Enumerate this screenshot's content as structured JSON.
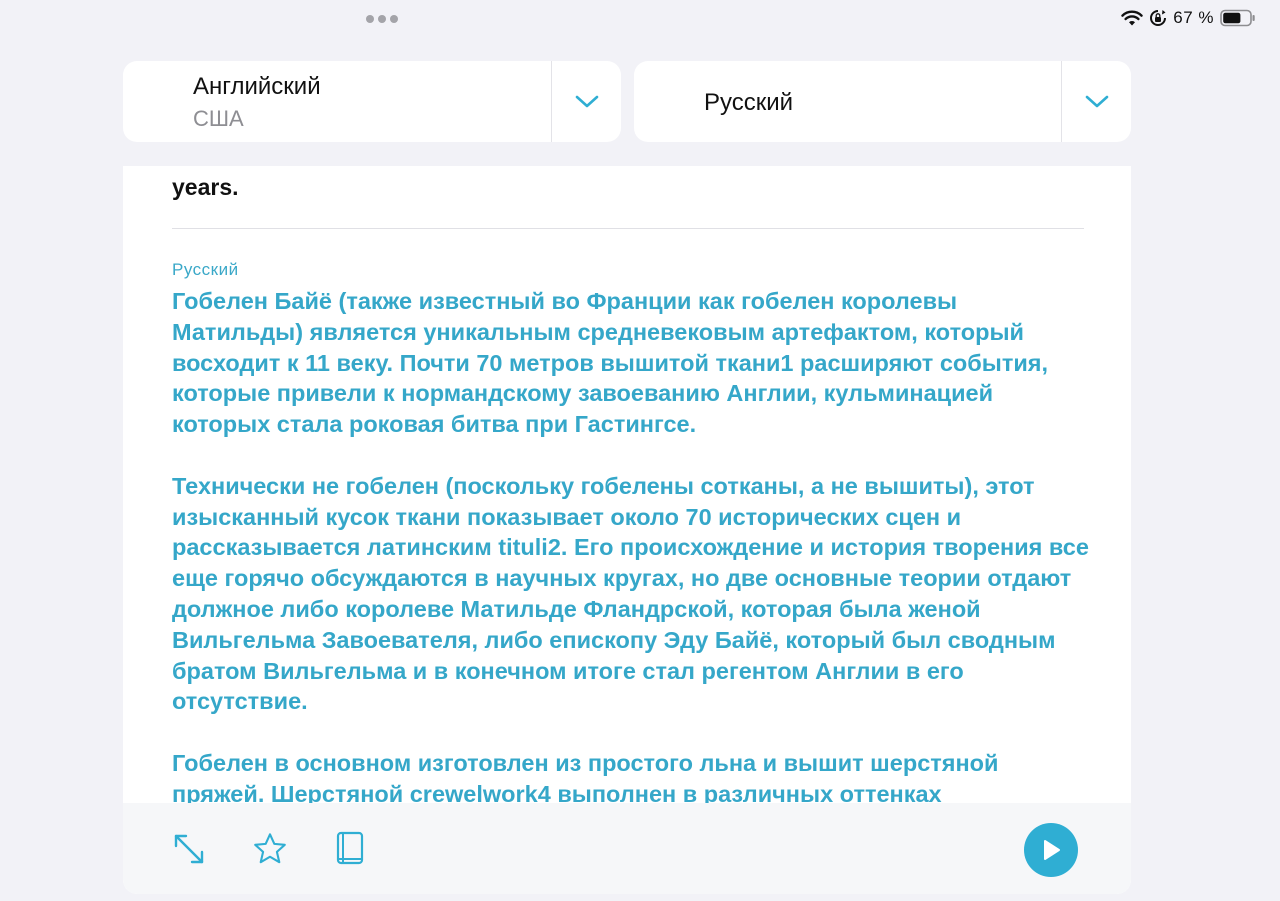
{
  "status_bar": {
    "battery_percent": "67 %",
    "battery_level": 0.67,
    "icons": [
      "wifi-icon",
      "lock-rotation-icon",
      "battery-icon"
    ]
  },
  "source_language": {
    "name": "Английский",
    "region": "США",
    "icon": "chevron-down-icon"
  },
  "target_language": {
    "name": "Русский",
    "icon": "chevron-down-icon"
  },
  "source_text_tail": "years.",
  "translation": {
    "label": "Русский",
    "paragraphs": [
      "Гобелен Байё (также известный во Франции как гобелен королевы Матильды) является уникальным средневековым артефактом, который восходит к 11 веку. Почти 70 метров вышитой ткани1 расширяют события, которые привели к нормандскому завоеванию Англии, кульминацией которых стала роковая битва при Гастингсе.",
      "Технически не гобелен (поскольку гобелены сотканы, а не вышиты), этот изысканный кусок ткани показывает около 70 исторических сцен и рассказывается латинским tituli2. Его происхождение и история творения все еще горячо обсуждаются в научных кругах, но две основные теории отдают должное либо королеве Матильде Фландрской, которая была женой Вильгельма Завоевателя, либо епископу Эду Байё, который был сводным братом Вильгельма и в конечном итоге стал регентом Англии в его отсутствие.",
      "Гобелен в основном изготовлен из простого льна и вышит шерстяной пряжей. Шерстяной crewelwork4 выполнен в различных оттенках"
    ],
    "color": "#35a7c9"
  },
  "toolbar": {
    "icons": [
      "expand-icon",
      "star-icon",
      "book-icon",
      "play-icon"
    ],
    "accent": "#2faed3"
  }
}
